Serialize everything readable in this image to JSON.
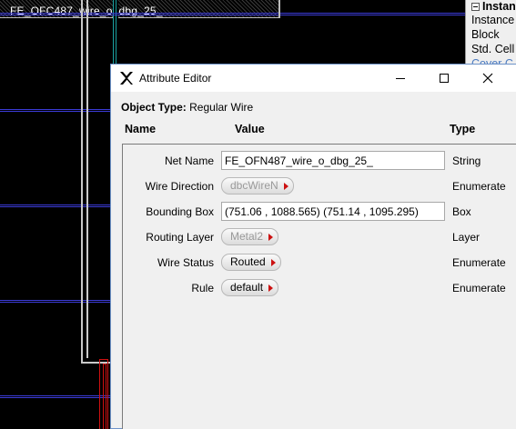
{
  "canvas": {
    "net_label": "FE_OFC487_wire_o_dbg_25_"
  },
  "side_panel": {
    "header": "Instan",
    "items": [
      "Instance",
      "Block",
      "Std. Cell",
      "Cover C"
    ]
  },
  "dialog": {
    "title": "Attribute Editor",
    "object_type_label": "Object Type:",
    "object_type_value": "Regular Wire",
    "columns": {
      "name": "Name",
      "value": "Value",
      "type": "Type"
    },
    "rows": {
      "net_name": {
        "label": "Net Name",
        "value": "FE_OFN487_wire_o_dbg_25_",
        "type": "String"
      },
      "wire_direction": {
        "label": "Wire Direction",
        "value": "dbcWireN",
        "type": "Enumerate",
        "enabled": false
      },
      "bounding_box": {
        "label": "Bounding Box",
        "value": "(751.06 , 1088.565) (751.14 , 1095.295)",
        "type": "Box"
      },
      "routing_layer": {
        "label": "Routing Layer",
        "value": "Metal2",
        "type": "Layer",
        "enabled": false
      },
      "wire_status": {
        "label": "Wire Status",
        "value": "Routed",
        "type": "Enumerate",
        "enabled": true
      },
      "rule": {
        "label": "Rule",
        "value": "default",
        "type": "Enumerate",
        "enabled": true
      }
    },
    "icons": {
      "app": "x-logo-icon",
      "minimize": "minimize-icon",
      "maximize": "maximize-icon",
      "close": "close-icon"
    }
  },
  "colors": {
    "canvas_bg": "#000000",
    "metal_line": "#3b3bd6",
    "dropdown_arrow": "#cc1111",
    "dialog_border": "#6e93c9"
  }
}
